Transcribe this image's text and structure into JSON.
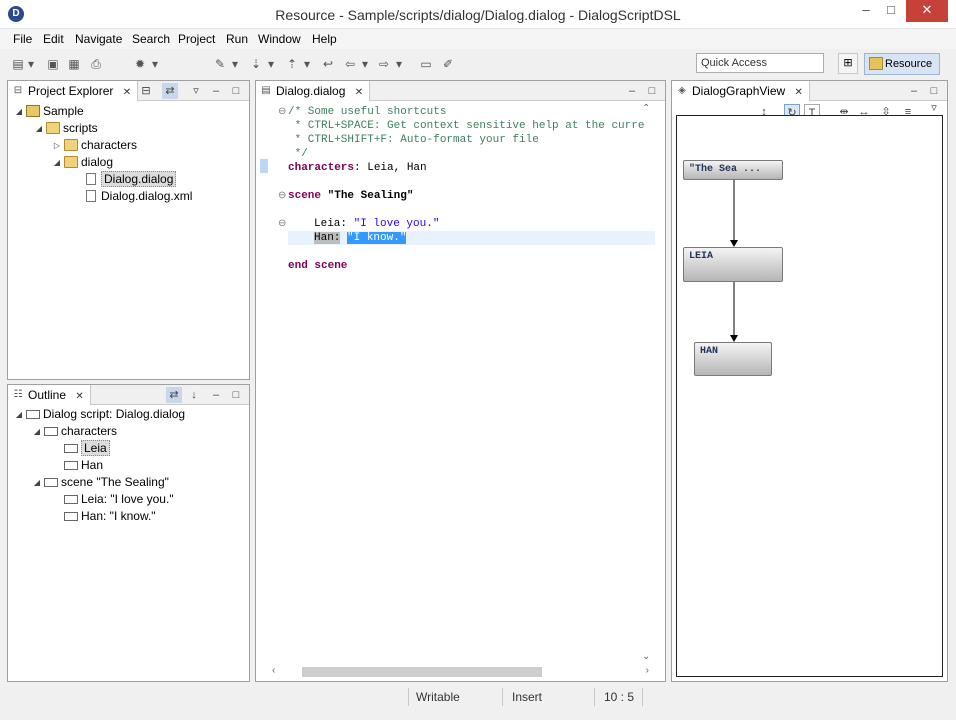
{
  "window": {
    "title": "Resource - Sample/scripts/dialog/Dialog.dialog - DialogScriptDSL"
  },
  "menu": [
    "File",
    "Edit",
    "Navigate",
    "Search",
    "Project",
    "Run",
    "Window",
    "Help"
  ],
  "toolbar": {
    "quick_access": "Quick Access",
    "perspective": "Resource"
  },
  "project_explorer": {
    "tab": "Project Explorer",
    "tree": [
      "Sample",
      "scripts",
      "characters",
      "dialog",
      "Dialog.dialog",
      "Dialog.dialog.xml"
    ]
  },
  "outline": {
    "tab": "Outline",
    "tree": [
      "Dialog script: Dialog.dialog",
      "characters",
      "Leia",
      "Han",
      "scene \"The Sealing\"",
      "Leia: \"I love you.\"",
      "Han: \"I know.\""
    ]
  },
  "editor": {
    "tab": "Dialog.dialog",
    "lines": {
      "c1": "/* Some useful shortcuts",
      "c2": " * CTRL+SPACE: Get context sensitive help at the curre",
      "c3": " * CTRL+SHIFT+F: Auto-format your file",
      "c4": " */",
      "chars_kw": "characters",
      "chars_rest": ": Leia, Han",
      "scene_kw": "scene",
      "scene_name": " \"The Sealing\"",
      "leia_name": "Leia",
      "leia_colon": ": ",
      "leia_str": "\"I love you.\"",
      "han_name": "Han:",
      "han_space": " ",
      "han_str": "\"I know.\"",
      "end": "end scene"
    }
  },
  "graph": {
    "tab": "DialogGraphView",
    "nodes": [
      "\"The Sea ...",
      "LEIA",
      "HAN"
    ]
  },
  "status": {
    "mode": "Writable",
    "insert": "Insert",
    "position": "10 : 5"
  }
}
